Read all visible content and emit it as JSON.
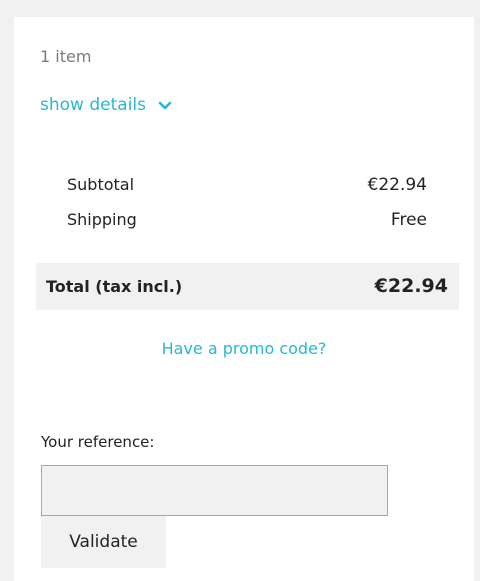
{
  "cart": {
    "items_count": "1 item",
    "show_details_label": "show details"
  },
  "summary": {
    "subtotal_label": "Subtotal",
    "subtotal_value": "€22.94",
    "shipping_label": "Shipping",
    "shipping_value": "Free",
    "total_label": "Total (tax incl.)",
    "total_value": "€22.94"
  },
  "promo": {
    "link_label": "Have a promo code?"
  },
  "reference": {
    "label": "Your reference:",
    "input_value": "",
    "button_label": "Validate"
  },
  "colors": {
    "accent": "#24b9d7",
    "panel_background": "#f1f1f1",
    "text": "#232323"
  },
  "icons": {
    "show_details": "chevron-down-icon"
  }
}
